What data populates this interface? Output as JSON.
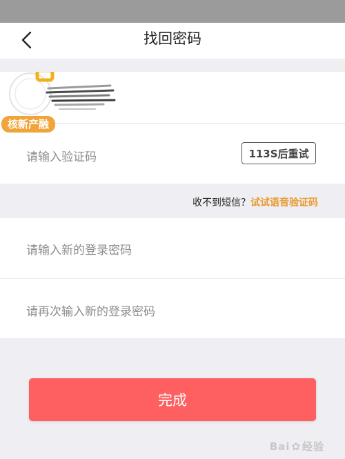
{
  "header": {
    "title": "找回密码",
    "back_icon": "chevron-left-icon"
  },
  "phone_row": {
    "badge": "核新产融"
  },
  "verification": {
    "placeholder": "请输入验证码",
    "resend_label": "113S后重试"
  },
  "voice": {
    "prompt": "收不到短信？",
    "link": "试试语音验证码"
  },
  "password": {
    "new_placeholder": "请输入新的登录密码",
    "confirm_placeholder": "请再次输入新的登录密码"
  },
  "done_label": "完成",
  "watermark": {
    "prefix": "Bai",
    "suffix": "经验"
  },
  "colors": {
    "primary_button": "#fe5f60",
    "link": "#e89a2e",
    "badge": "#f0a43a",
    "status_bar": "#9b9b9b",
    "background": "#efeef3"
  }
}
